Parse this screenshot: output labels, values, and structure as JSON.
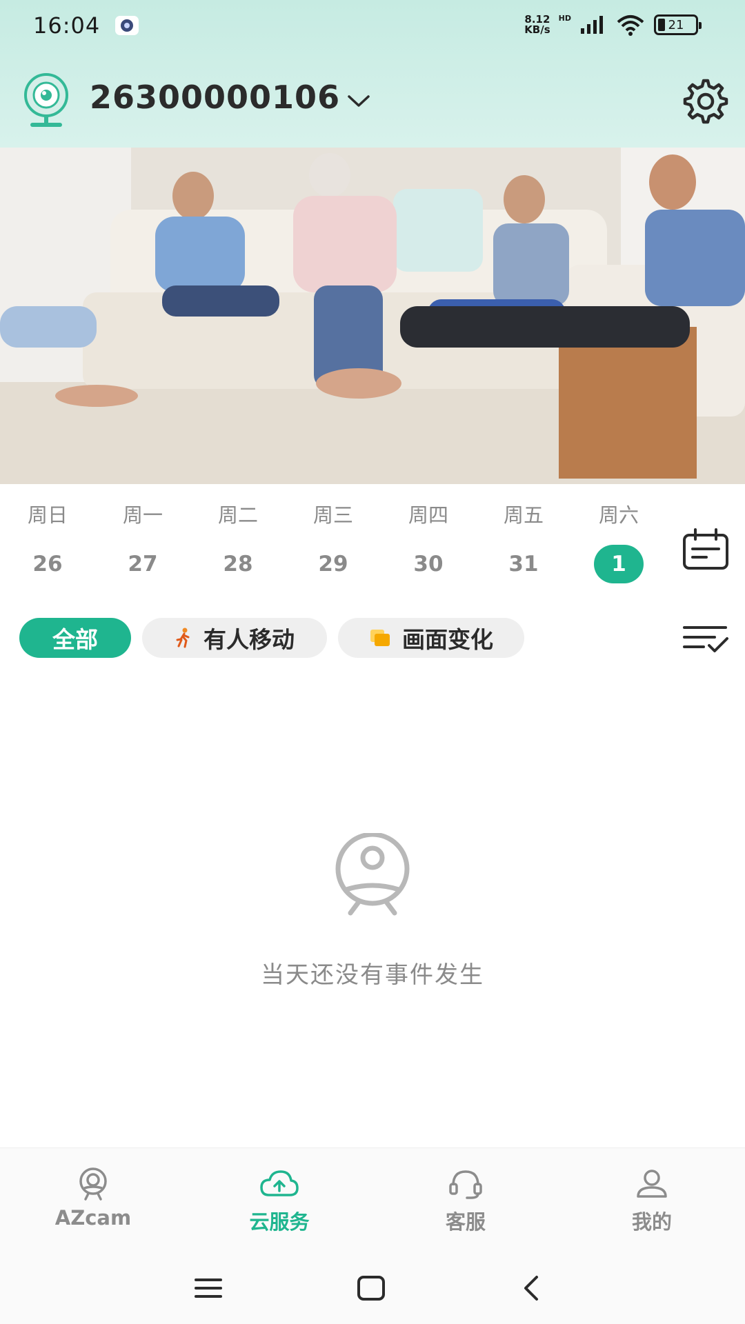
{
  "status_bar": {
    "time": "16:04",
    "net_speed_value": "8.12",
    "net_speed_unit": "KB/s",
    "hd_tag": "HD",
    "battery_level": "21"
  },
  "header": {
    "device_name": "26300000106",
    "camera_icon": "camera-icon",
    "dropdown_icon": "chevron-down-icon",
    "settings_icon": "gear-icon"
  },
  "week": {
    "days": [
      {
        "name": "周日",
        "num": "26"
      },
      {
        "name": "周一",
        "num": "27"
      },
      {
        "name": "周二",
        "num": "28"
      },
      {
        "name": "周三",
        "num": "29"
      },
      {
        "name": "周四",
        "num": "30"
      },
      {
        "name": "周五",
        "num": "31"
      },
      {
        "name": "周六",
        "num": "1"
      }
    ],
    "selected_index": 6
  },
  "filters": {
    "all": "全部",
    "motion": "有人移动",
    "scene_change": "画面变化"
  },
  "empty_state": {
    "message": "当天还没有事件发生"
  },
  "bottom_nav": {
    "items": [
      {
        "label": "AZcam",
        "icon": "camera-icon"
      },
      {
        "label": "云服务",
        "icon": "cloud-upload-icon"
      },
      {
        "label": "客服",
        "icon": "headset-icon"
      },
      {
        "label": "我的",
        "icon": "person-icon"
      }
    ],
    "active_index": 1
  },
  "colors": {
    "accent": "#1fb58f",
    "header_bg": "#c6ebe2",
    "muted_text": "#8a8a8a"
  }
}
